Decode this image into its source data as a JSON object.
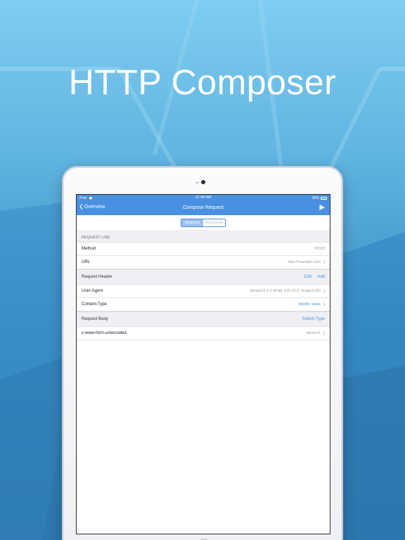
{
  "headline": "HTTP Composer",
  "status_bar": {
    "device": "iPad",
    "time": "12:48 AM",
    "battery": "56%"
  },
  "nav": {
    "back_label": "Overview",
    "title": "Compose Request"
  },
  "segments": [
    "Request",
    "Response"
  ],
  "request_line": {
    "section_title": "REQUEST LINE",
    "method_label": "Method",
    "method_value": "POST",
    "url_label": "URL",
    "url_value": "http://example.com"
  },
  "request_header": {
    "title": "Request Header",
    "edit_label": "Edit",
    "add_label": "Add",
    "rows": [
      {
        "label": "User-Agent",
        "value": "Stream/1.0.2 (iPad; iOS 11.3; Scale/2.00)"
      },
      {
        "label": "Content-Type",
        "value": "Modify Value"
      }
    ]
  },
  "request_body": {
    "title": "Request Body",
    "switch_label": "Switch Type",
    "rows": [
      {
        "label": "x-www-form-urlencoded",
        "value": "demo=1"
      }
    ]
  },
  "colors": {
    "accent": "#4a90e2",
    "background_top": "#7fcdf1",
    "background_bottom": "#2e77ad"
  }
}
